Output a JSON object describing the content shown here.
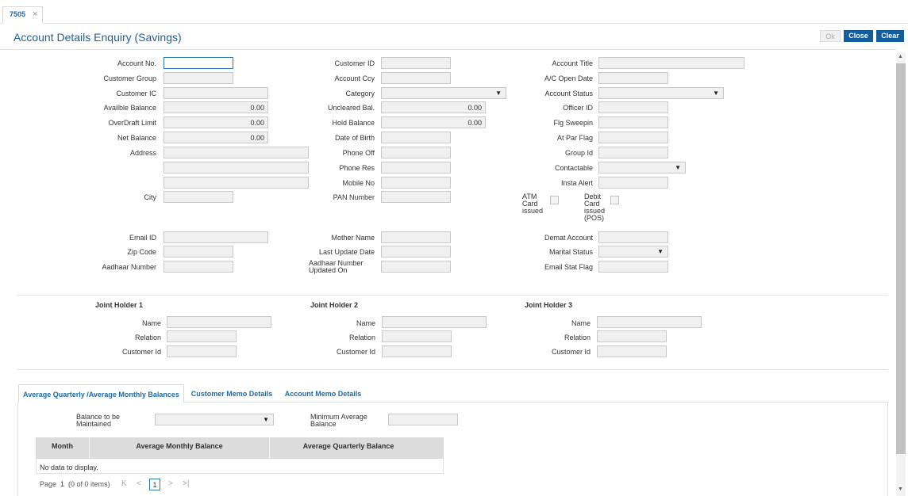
{
  "tab": {
    "label": "7505",
    "close": "×"
  },
  "title": "Account Details Enquiry (Savings)",
  "buttons": {
    "ok": "Ok",
    "close": "Close",
    "clear": "Clear"
  },
  "col1": {
    "account_no": "Account No.",
    "customer_group": "Customer Group",
    "customer_ic": "Customer IC",
    "available_balance": "Availble Balance",
    "available_balance_value": "0.00",
    "overdraft_limit": "OverDraft Limit",
    "overdraft_limit_value": "0.00",
    "net_balance": "Net Balance",
    "net_balance_value": "0.00",
    "address": "Address",
    "city": "City",
    "email_id": "Email ID",
    "zip_code": "Zip Code",
    "aadhaar_number": "Aadhaar Number"
  },
  "col2": {
    "customer_id": "Customer ID",
    "account_ccy": "Account Ccy",
    "category": "Category",
    "uncleared_bal": "Uncleared Bal.",
    "uncleared_bal_value": "0.00",
    "hold_balance": "Hold Balance",
    "hold_balance_value": "0.00",
    "date_of_birth": "Date of Birth",
    "phone_off": "Phone Off",
    "phone_res": "Phone Res",
    "mobile_no": "Mobile No",
    "pan_number": "PAN Number",
    "mother_name": "Mother Name",
    "last_update_date": "Last Update Date",
    "aadhaar_updated_on": "Aadhaar Number Updated On"
  },
  "col3": {
    "account_title": "Account Title",
    "ac_open_date": "A/C Open Date",
    "account_status": "Account Status",
    "officer_id": "Officer ID",
    "flg_sweepin": "Flg Sweepin",
    "at_par_flag": "At Par Flag",
    "group_id": "Group Id",
    "contactable": "Contactable",
    "insta_alert": "Insta Alert",
    "atm_card_issued": "ATM Card issued",
    "debit_card_issued": "Debit Card issued (POS)",
    "demat_account": "Demat Account",
    "marital_status": "Marital Status",
    "email_stat_flag": "Email Stat Flag"
  },
  "joint_holders": [
    {
      "title": "Joint Holder 1",
      "name": "Name",
      "relation": "Relation",
      "customer_id": "Customer Id"
    },
    {
      "title": "Joint Holder 2",
      "name": "Name",
      "relation": "Relation",
      "customer_id": "Customer Id"
    },
    {
      "title": "Joint Holder 3",
      "name": "Name",
      "relation": "Relation",
      "customer_id": "Customer Id"
    }
  ],
  "bottom_tabs": [
    {
      "label": "Average Quarterly /Average Monthly Balances",
      "active": true
    },
    {
      "label": "Customer Memo Details",
      "active": false
    },
    {
      "label": "Account Memo Details",
      "active": false
    }
  ],
  "balance_panel": {
    "balance_to_be_maintained": "Balance to be Maintained",
    "minimum_average_balance": "Minimum Average Balance"
  },
  "grid": {
    "columns": [
      "Month",
      "Average Monthly Balance",
      "Average Quarterly Balance"
    ],
    "empty_text": "No data to display."
  },
  "pager": {
    "page_label": "Page",
    "page_number": "1",
    "items_text": "(0 of 0 items)",
    "current_page": "1",
    "first": "K",
    "prev": "<",
    "next": ">",
    "last": ">|"
  },
  "colors": {
    "accent": "#135d9e",
    "title": "#1f5f99",
    "input_bg": "#f0f0f0"
  }
}
